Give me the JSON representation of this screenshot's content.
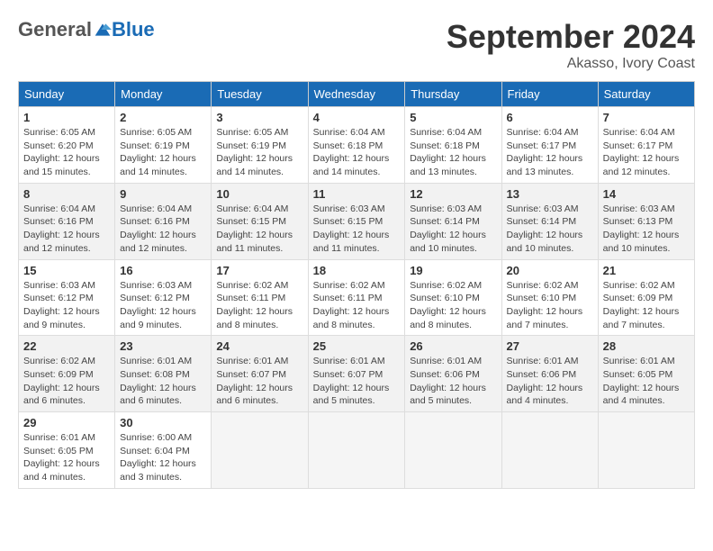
{
  "header": {
    "logo_general": "General",
    "logo_blue": "Blue",
    "month_title": "September 2024",
    "location": "Akasso, Ivory Coast"
  },
  "days_of_week": [
    "Sunday",
    "Monday",
    "Tuesday",
    "Wednesday",
    "Thursday",
    "Friday",
    "Saturday"
  ],
  "weeks": [
    [
      {
        "day": "1",
        "sunrise": "6:05 AM",
        "sunset": "6:20 PM",
        "daylight": "12 hours and 15 minutes."
      },
      {
        "day": "2",
        "sunrise": "6:05 AM",
        "sunset": "6:19 PM",
        "daylight": "12 hours and 14 minutes."
      },
      {
        "day": "3",
        "sunrise": "6:05 AM",
        "sunset": "6:19 PM",
        "daylight": "12 hours and 14 minutes."
      },
      {
        "day": "4",
        "sunrise": "6:04 AM",
        "sunset": "6:18 PM",
        "daylight": "12 hours and 14 minutes."
      },
      {
        "day": "5",
        "sunrise": "6:04 AM",
        "sunset": "6:18 PM",
        "daylight": "12 hours and 13 minutes."
      },
      {
        "day": "6",
        "sunrise": "6:04 AM",
        "sunset": "6:17 PM",
        "daylight": "12 hours and 13 minutes."
      },
      {
        "day": "7",
        "sunrise": "6:04 AM",
        "sunset": "6:17 PM",
        "daylight": "12 hours and 12 minutes."
      }
    ],
    [
      {
        "day": "8",
        "sunrise": "6:04 AM",
        "sunset": "6:16 PM",
        "daylight": "12 hours and 12 minutes."
      },
      {
        "day": "9",
        "sunrise": "6:04 AM",
        "sunset": "6:16 PM",
        "daylight": "12 hours and 12 minutes."
      },
      {
        "day": "10",
        "sunrise": "6:04 AM",
        "sunset": "6:15 PM",
        "daylight": "12 hours and 11 minutes."
      },
      {
        "day": "11",
        "sunrise": "6:03 AM",
        "sunset": "6:15 PM",
        "daylight": "12 hours and 11 minutes."
      },
      {
        "day": "12",
        "sunrise": "6:03 AM",
        "sunset": "6:14 PM",
        "daylight": "12 hours and 10 minutes."
      },
      {
        "day": "13",
        "sunrise": "6:03 AM",
        "sunset": "6:14 PM",
        "daylight": "12 hours and 10 minutes."
      },
      {
        "day": "14",
        "sunrise": "6:03 AM",
        "sunset": "6:13 PM",
        "daylight": "12 hours and 10 minutes."
      }
    ],
    [
      {
        "day": "15",
        "sunrise": "6:03 AM",
        "sunset": "6:12 PM",
        "daylight": "12 hours and 9 minutes."
      },
      {
        "day": "16",
        "sunrise": "6:03 AM",
        "sunset": "6:12 PM",
        "daylight": "12 hours and 9 minutes."
      },
      {
        "day": "17",
        "sunrise": "6:02 AM",
        "sunset": "6:11 PM",
        "daylight": "12 hours and 8 minutes."
      },
      {
        "day": "18",
        "sunrise": "6:02 AM",
        "sunset": "6:11 PM",
        "daylight": "12 hours and 8 minutes."
      },
      {
        "day": "19",
        "sunrise": "6:02 AM",
        "sunset": "6:10 PM",
        "daylight": "12 hours and 8 minutes."
      },
      {
        "day": "20",
        "sunrise": "6:02 AM",
        "sunset": "6:10 PM",
        "daylight": "12 hours and 7 minutes."
      },
      {
        "day": "21",
        "sunrise": "6:02 AM",
        "sunset": "6:09 PM",
        "daylight": "12 hours and 7 minutes."
      }
    ],
    [
      {
        "day": "22",
        "sunrise": "6:02 AM",
        "sunset": "6:09 PM",
        "daylight": "12 hours and 6 minutes."
      },
      {
        "day": "23",
        "sunrise": "6:01 AM",
        "sunset": "6:08 PM",
        "daylight": "12 hours and 6 minutes."
      },
      {
        "day": "24",
        "sunrise": "6:01 AM",
        "sunset": "6:07 PM",
        "daylight": "12 hours and 6 minutes."
      },
      {
        "day": "25",
        "sunrise": "6:01 AM",
        "sunset": "6:07 PM",
        "daylight": "12 hours and 5 minutes."
      },
      {
        "day": "26",
        "sunrise": "6:01 AM",
        "sunset": "6:06 PM",
        "daylight": "12 hours and 5 minutes."
      },
      {
        "day": "27",
        "sunrise": "6:01 AM",
        "sunset": "6:06 PM",
        "daylight": "12 hours and 4 minutes."
      },
      {
        "day": "28",
        "sunrise": "6:01 AM",
        "sunset": "6:05 PM",
        "daylight": "12 hours and 4 minutes."
      }
    ],
    [
      {
        "day": "29",
        "sunrise": "6:01 AM",
        "sunset": "6:05 PM",
        "daylight": "12 hours and 4 minutes."
      },
      {
        "day": "30",
        "sunrise": "6:00 AM",
        "sunset": "6:04 PM",
        "daylight": "12 hours and 3 minutes."
      },
      null,
      null,
      null,
      null,
      null
    ]
  ]
}
